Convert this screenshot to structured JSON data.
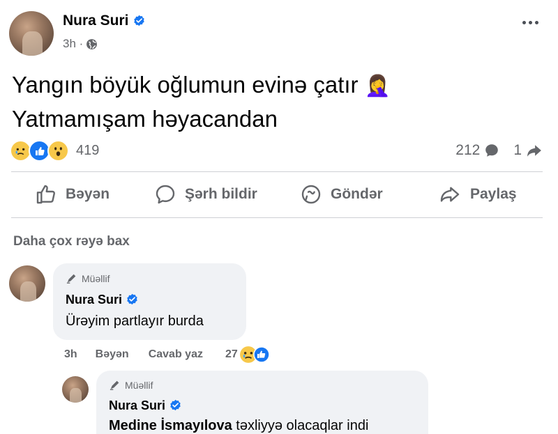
{
  "post": {
    "author": "Nura Suri",
    "time": "3h ·",
    "text_line1": "Yangın böyük oğlumun evinə çatır",
    "text_line2": "Yatmamışam həyacandan",
    "emoji": "🤦‍♀️",
    "reaction_count": "419",
    "comment_count": "212",
    "share_count": "1"
  },
  "actions": {
    "like": "Bəyən",
    "comment": "Şərh bildir",
    "send": "Göndər",
    "share": "Paylaş"
  },
  "more_comments": "Daha çox rəyə bax",
  "comments": [
    {
      "badge": "Müəllif",
      "author": "Nura Suri",
      "text": "Ürəyim partlayır burda",
      "time": "3h",
      "like": "Bəyən",
      "reply": "Cavab yaz",
      "reaction_count": "27"
    },
    {
      "badge": "Müəllif",
      "author": "Nura Suri",
      "mention": "Medine İsmayılova",
      "text": " təxliyyə olacaqlar indi"
    }
  ],
  "colors": {
    "facebook_blue": "#1877f2",
    "secondary_text": "#65676b",
    "bubble_bg": "#f0f2f5"
  },
  "icons": [
    "verified-icon",
    "globe-icon",
    "more-icon",
    "like-icon",
    "comment-icon",
    "messenger-icon",
    "share-icon",
    "pencil-icon",
    "sad-reaction-icon",
    "wow-reaction-icon"
  ]
}
